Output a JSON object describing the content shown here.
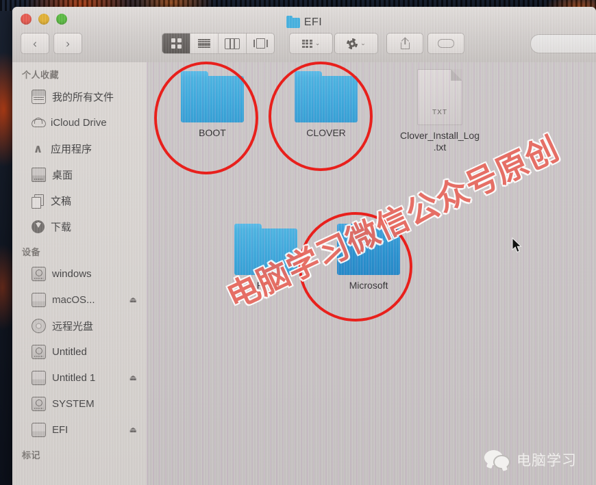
{
  "window": {
    "title": "EFI",
    "title_icon": "folder-icon",
    "traffic_lights": [
      {
        "name": "close",
        "color": "#e8554a"
      },
      {
        "name": "minimize",
        "color": "#e3b02c"
      },
      {
        "name": "zoom",
        "color": "#54b93a"
      }
    ]
  },
  "toolbar": {
    "back_label": "‹",
    "forward_label": "›",
    "view_modes": [
      {
        "name": "icon-view",
        "selected": true
      },
      {
        "name": "list-view",
        "selected": false
      },
      {
        "name": "column-view",
        "selected": false
      },
      {
        "name": "coverflow-view",
        "selected": false
      }
    ],
    "arrange_label": "",
    "action_label": "",
    "share_label": "",
    "tag_label": "",
    "chevron": "⌄"
  },
  "search": {
    "value": "",
    "placeholder": ""
  },
  "sidebar": {
    "sections": [
      {
        "header": "个人收藏",
        "items": [
          {
            "label": "我的所有文件",
            "icon": "all-files-icon",
            "eject": false
          },
          {
            "label": "iCloud Drive",
            "icon": "icloud-icon",
            "eject": false
          },
          {
            "label": "应用程序",
            "icon": "applications-icon",
            "eject": false
          },
          {
            "label": "桌面",
            "icon": "desktop-icon",
            "eject": false
          },
          {
            "label": "文稿",
            "icon": "documents-icon",
            "eject": false
          },
          {
            "label": "下载",
            "icon": "downloads-icon",
            "eject": false
          }
        ]
      },
      {
        "header": "设备",
        "items": [
          {
            "label": "windows",
            "icon": "external-disk-icon",
            "eject": false
          },
          {
            "label": "macOS...",
            "icon": "internal-disk-icon",
            "eject": true
          },
          {
            "label": "远程光盘",
            "icon": "optical-disc-icon",
            "eject": false
          },
          {
            "label": "Untitled",
            "icon": "external-disk-icon",
            "eject": false
          },
          {
            "label": "Untitled 1",
            "icon": "internal-disk-icon",
            "eject": true
          },
          {
            "label": "SYSTEM",
            "icon": "external-disk-icon",
            "eject": false
          },
          {
            "label": "EFI",
            "icon": "internal-disk-icon",
            "eject": true
          }
        ]
      },
      {
        "header": "标记",
        "items": []
      }
    ],
    "eject_glyph": "⏏"
  },
  "files": [
    {
      "name": "BOOT",
      "type": "folder",
      "circled": true
    },
    {
      "name": "CLOVER",
      "type": "folder",
      "circled": true
    },
    {
      "name": "Clover_Install_Log\n.txt",
      "name_line1": "Clover_Install_Log",
      "name_line2": ".txt",
      "type": "txt",
      "badge": "TXT",
      "circled": false
    },
    {
      "name": "APPLE",
      "type": "folder",
      "circled": false
    },
    {
      "name": "Microsoft",
      "type": "folder",
      "circled": true
    }
  ],
  "annotations": {
    "circle_color": "#e8201c",
    "watermark_text": "电脑学习微信公众号原创",
    "watermark_color": "#e8695f"
  },
  "badge": {
    "icon": "wechat-icon",
    "text": "电脑学习"
  },
  "colors": {
    "folder_blue": "#35a8de",
    "window_chrome": "#d6d2ce",
    "accent_red": "#e8201c"
  }
}
